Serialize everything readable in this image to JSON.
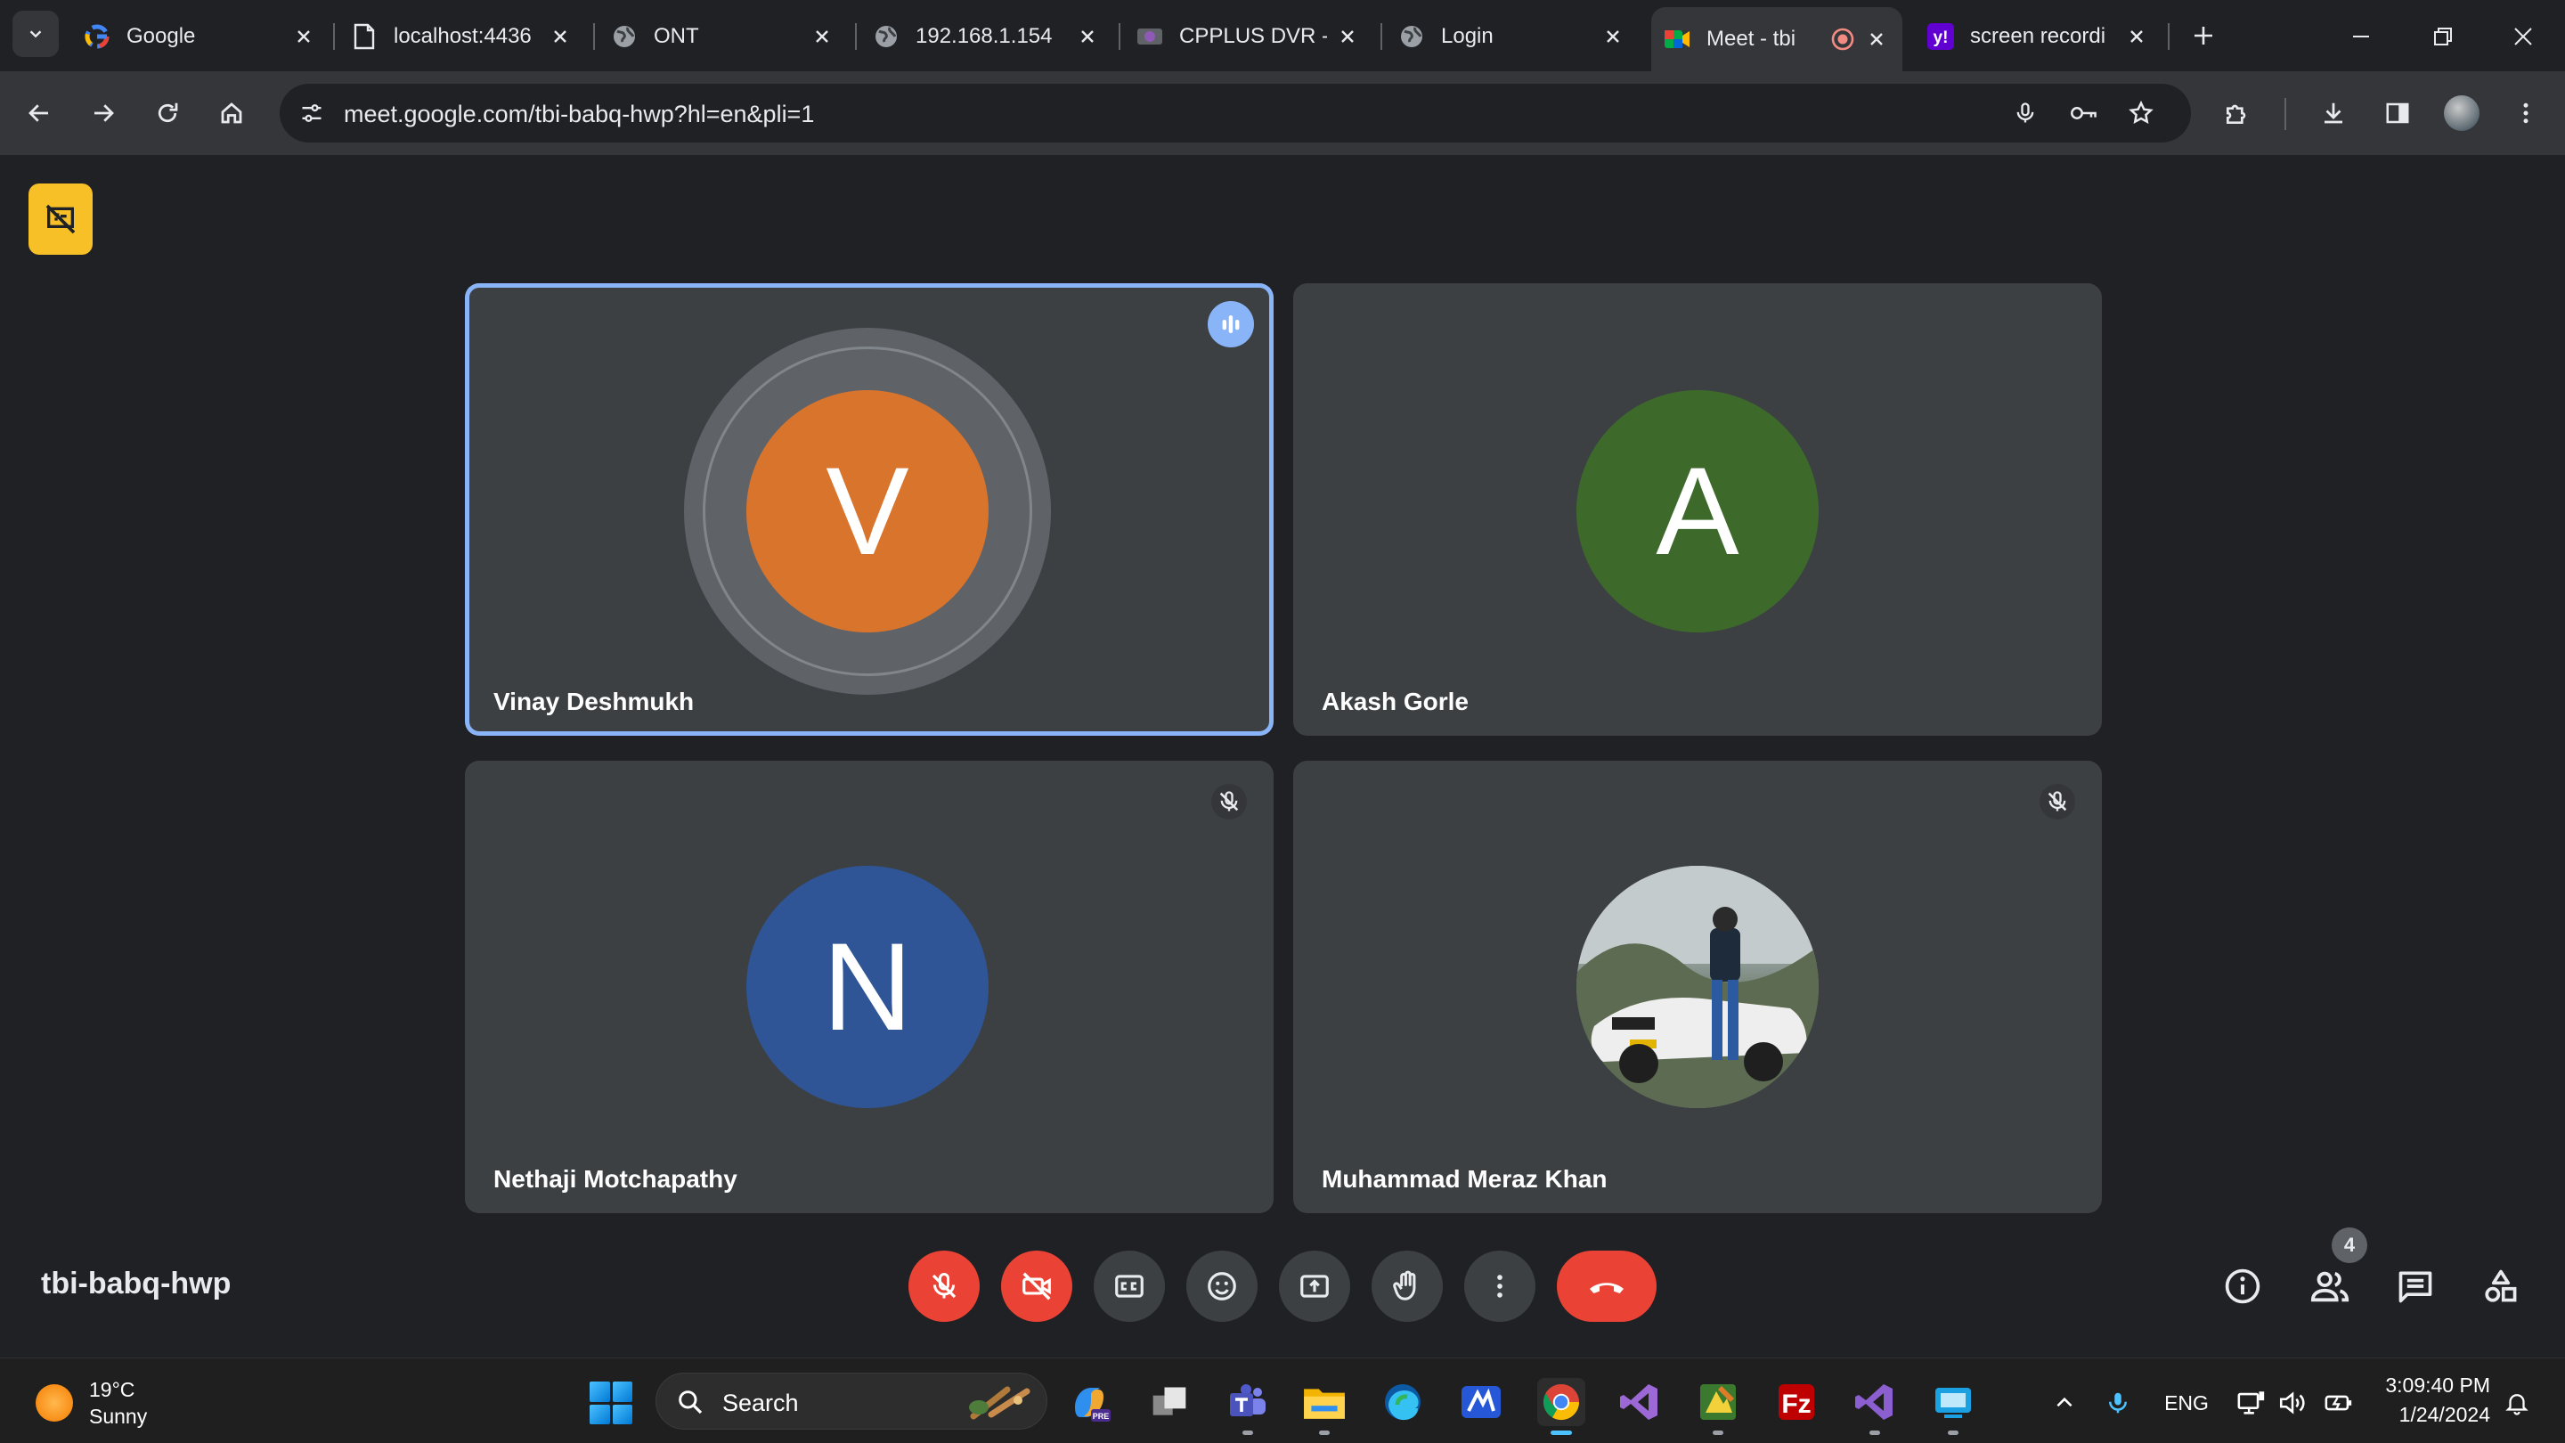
{
  "browser": {
    "tabs": [
      {
        "title": "Google",
        "active": false
      },
      {
        "title": "localhost:4436",
        "active": false
      },
      {
        "title": "ONT",
        "active": false
      },
      {
        "title": "192.168.1.154",
        "active": false
      },
      {
        "title": "CPPLUS DVR -",
        "active": false
      },
      {
        "title": "Login",
        "active": false
      },
      {
        "title": "Meet - tbi",
        "active": true
      },
      {
        "title": "screen recordi",
        "active": false
      }
    ],
    "url": "meet.google.com/tbi-babq-hwp?hl=en&pli=1"
  },
  "meet": {
    "participants": [
      {
        "name": "Vinay Deshmukh",
        "initial": "V",
        "color": "#d9742d",
        "speaking": true,
        "muted": false
      },
      {
        "name": "Akash Gorle",
        "initial": "A",
        "color": "#3d6a2b",
        "speaking": false,
        "muted": false
      },
      {
        "name": "Nethaji Motchapathy",
        "initial": "N",
        "color": "#2f5597",
        "speaking": false,
        "muted": true
      },
      {
        "name": "Muhammad Meraz Khan",
        "initial": "",
        "color": "",
        "speaking": false,
        "muted": true
      }
    ],
    "meeting_code": "tbi-babq-hwp",
    "participant_count": "4"
  },
  "taskbar": {
    "weather_temp": "19°C",
    "weather_desc": "Sunny",
    "search_label": "Search",
    "language": "ENG",
    "time": "3:09:40 PM",
    "date": "1/24/2024"
  },
  "colors": {
    "speaking_border": "#8ab4f8",
    "end_call": "#ea4335",
    "tile_bg": "#3c4043"
  }
}
